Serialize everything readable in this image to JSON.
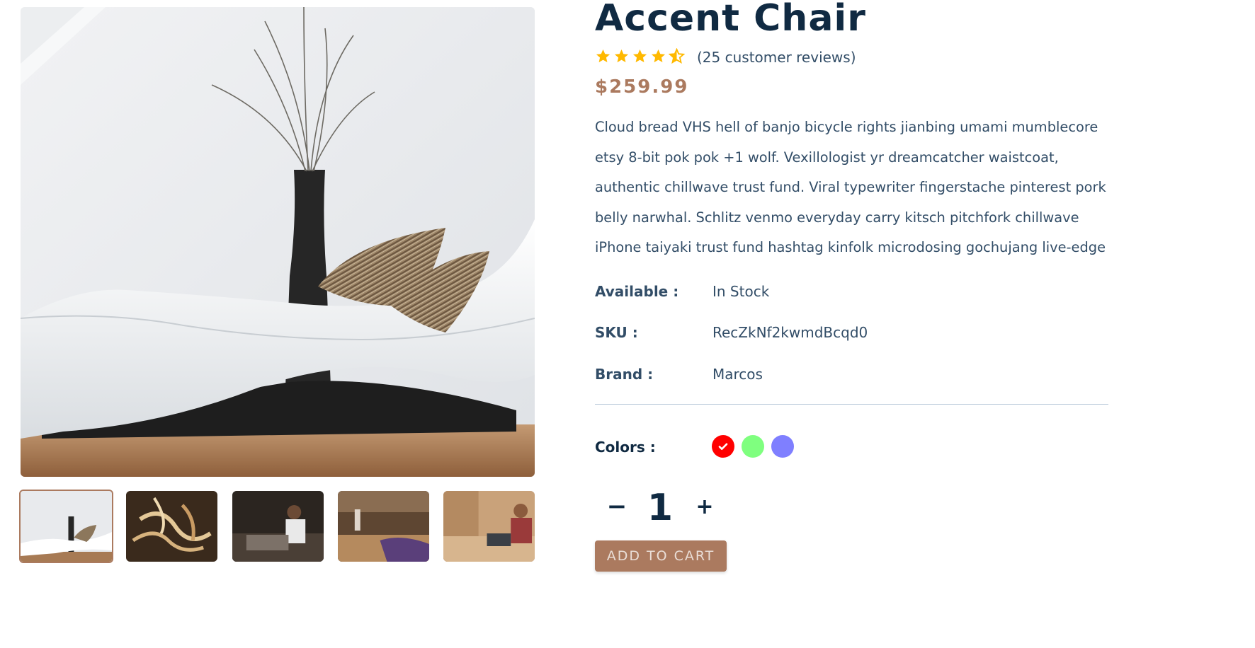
{
  "product": {
    "title": "Accent Chair",
    "rating": 4.5,
    "max_rating": 5,
    "reviews_text": "(25 customer reviews)",
    "price": "$259.99",
    "description": "Cloud bread VHS hell of banjo bicycle rights jianbing umami mumblecore etsy 8-bit pok pok +1 wolf. Vexillologist yr dreamcatcher waistcoat, authentic chillwave trust fund. Viral typewriter fingerstache pinterest pork belly narwhal. Schlitz venmo everyday carry kitsch pitchfork chillwave iPhone taiyaki trust fund hashtag kinfolk microdosing gochujang live-edge"
  },
  "info": {
    "available_label": "Available :",
    "available_value": "In Stock",
    "sku_label": "SKU :",
    "sku_value": "RecZkNf2kwmdBcqd0",
    "brand_label": "Brand :",
    "brand_value": "Marcos"
  },
  "colors": {
    "label": "Colors :",
    "options": [
      "#ff0000",
      "#00ff00",
      "#0000ff"
    ],
    "selected_index": 0
  },
  "quantity": {
    "minus_label": "−",
    "value": "1",
    "plus_label": "+"
  },
  "cart": {
    "button_label": "ADD TO CART"
  },
  "gallery": {
    "thumbnails": [
      "lounge-chair-image",
      "wood-shavings-image",
      "woodworker-image",
      "workshop-image",
      "carpenter-laptop-image"
    ],
    "active_index": 0
  },
  "theme": {
    "accent": "#ab7a5f",
    "heading": "#102a42",
    "text": "#324d67",
    "star": "#ffb900"
  }
}
